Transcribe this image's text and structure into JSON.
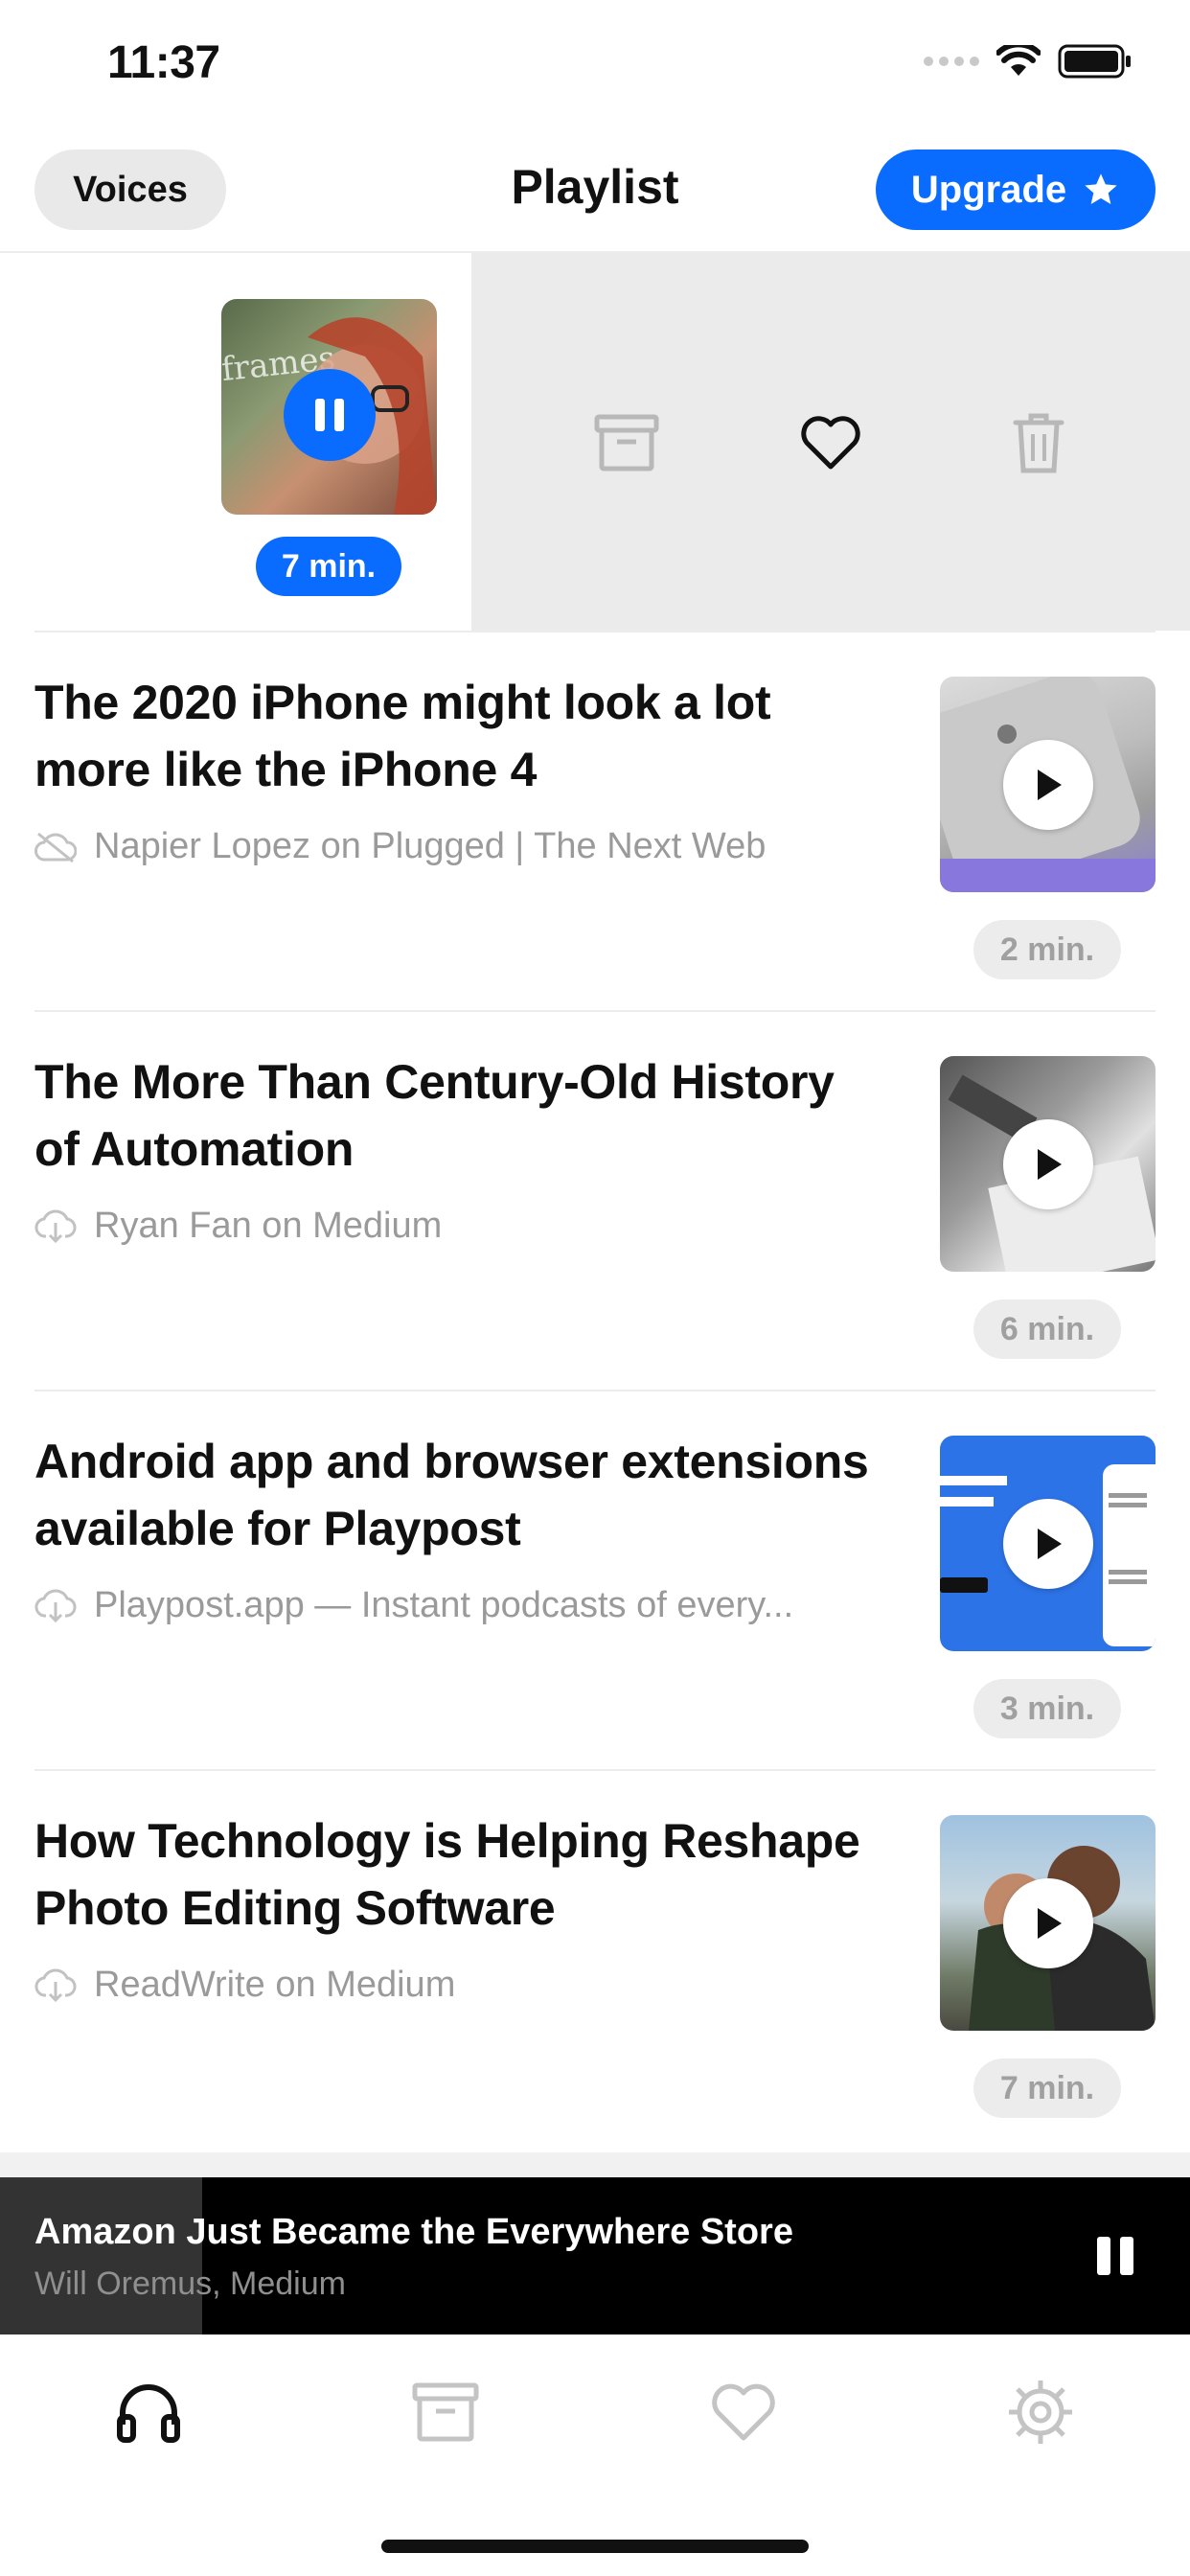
{
  "status_bar": {
    "time": "11:37"
  },
  "header": {
    "voices_label": "Voices",
    "title": "Playlist",
    "upgrade_label": "Upgrade"
  },
  "now_playing_row": {
    "thumbnail_text": "frames",
    "duration": "7 min.",
    "actions": [
      "archive-icon",
      "heart-icon",
      "trash-icon"
    ]
  },
  "articles": [
    {
      "title": "The 2020 iPhone might look a lot more like the iPhone 4",
      "source": "Napier Lopez on Plugged | The Next Web",
      "status_icon": "cloud-offline-icon",
      "duration": "2 min."
    },
    {
      "title": "The More Than Century-Old History of Automation",
      "source": "Ryan Fan on Medium",
      "status_icon": "cloud-download-icon",
      "duration": "6 min."
    },
    {
      "title": "Android app and browser extensions available for Playpost",
      "source": "Playpost.app — Instant podcasts of every...",
      "status_icon": "cloud-download-icon",
      "duration": "3 min."
    },
    {
      "title": "How Technology is Helping Reshape Photo Editing Software",
      "source": "ReadWrite on Medium",
      "status_icon": "cloud-download-icon",
      "duration": "7 min."
    }
  ],
  "mini_player": {
    "title": "Amazon Just Became the Everywhere Store",
    "subtitle": "Will Oremus, Medium",
    "progress": 0.17
  },
  "tab_bar": {
    "tabs": [
      "headphones-icon",
      "archive-icon",
      "heart-icon",
      "settings-icon"
    ],
    "active_tab": "headphones-icon"
  },
  "colors": {
    "accent": "#0a6cff",
    "swipe_background": "#ebebeb",
    "muted_text": "#9a9a9a"
  }
}
